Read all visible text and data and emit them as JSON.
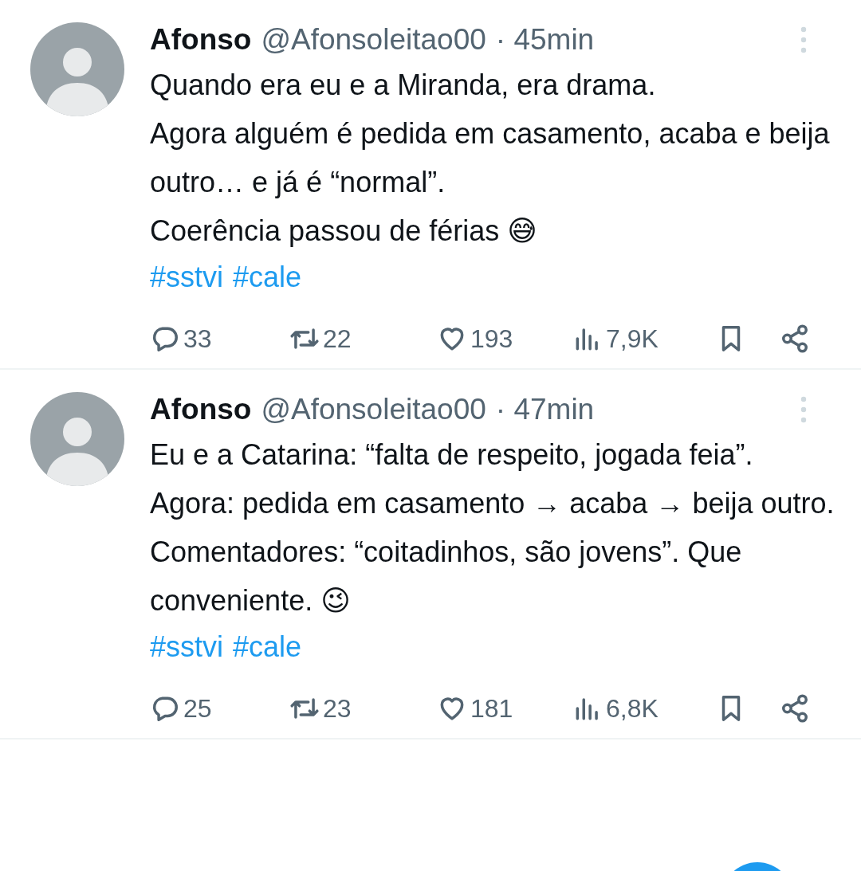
{
  "tweets": [
    {
      "name": "Afonso",
      "handle": "@Afonsoleitao00",
      "time": "· 45min",
      "body": "Quando era eu e a Miranda, era drama.\nAgora alguém é pedida em casamento, acaba e beija outro… e já é “normal”.\nCoerência passou de férias 😅",
      "hashtags": [
        "#sstvi",
        "#cale"
      ],
      "replies": "33",
      "reposts": "22",
      "likes": "193",
      "views": "7,9K"
    },
    {
      "name": "Afonso",
      "handle": "@Afonsoleitao00",
      "time": "· 47min",
      "body": "Eu e a Catarina: “falta de respeito, jogada feia”.\nAgora: pedida em casamento → acaba → beija outro.\nComentadores: “coitadinhos, são jovens”. Que conveniente. 😉",
      "hashtags": [
        "#sstvi",
        "#cale"
      ],
      "replies": "25",
      "reposts": "23",
      "likes": "181",
      "views": "6,8K"
    }
  ]
}
